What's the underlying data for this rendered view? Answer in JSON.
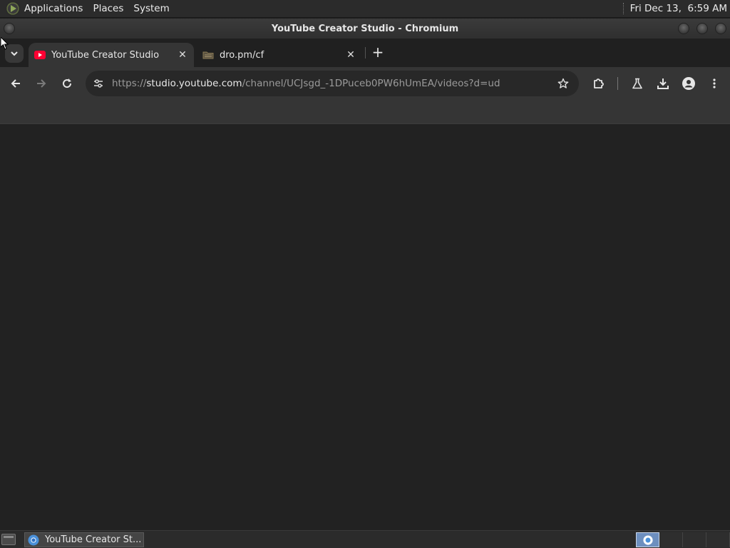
{
  "top_panel": {
    "menus": [
      "Applications",
      "Places",
      "System"
    ],
    "clock": "Fri Dec 13,  6:59 AM"
  },
  "window": {
    "title": "YouTube Creator Studio - Chromium"
  },
  "tabs": [
    {
      "title": "YouTube Creator Studio",
      "active": true,
      "favicon": "youtube-icon",
      "favicon_color": "#ff0033"
    },
    {
      "title": "dro.pm/cf",
      "active": false,
      "favicon": "folder-icon"
    }
  ],
  "omnibox": {
    "scheme": "https://",
    "host": "studio.youtube.com",
    "path": "/channel/UCJsgd_-1DPuceb0PW6hUmEA/videos?d=ud"
  },
  "taskbar": {
    "items": [
      {
        "label": "YouTube Creator St...",
        "icon": "chromium-icon"
      }
    ],
    "workspaces": 4,
    "current_workspace": 1
  },
  "colors": {
    "accent": "#6d8fbf",
    "youtube_red": "#ff0033"
  }
}
